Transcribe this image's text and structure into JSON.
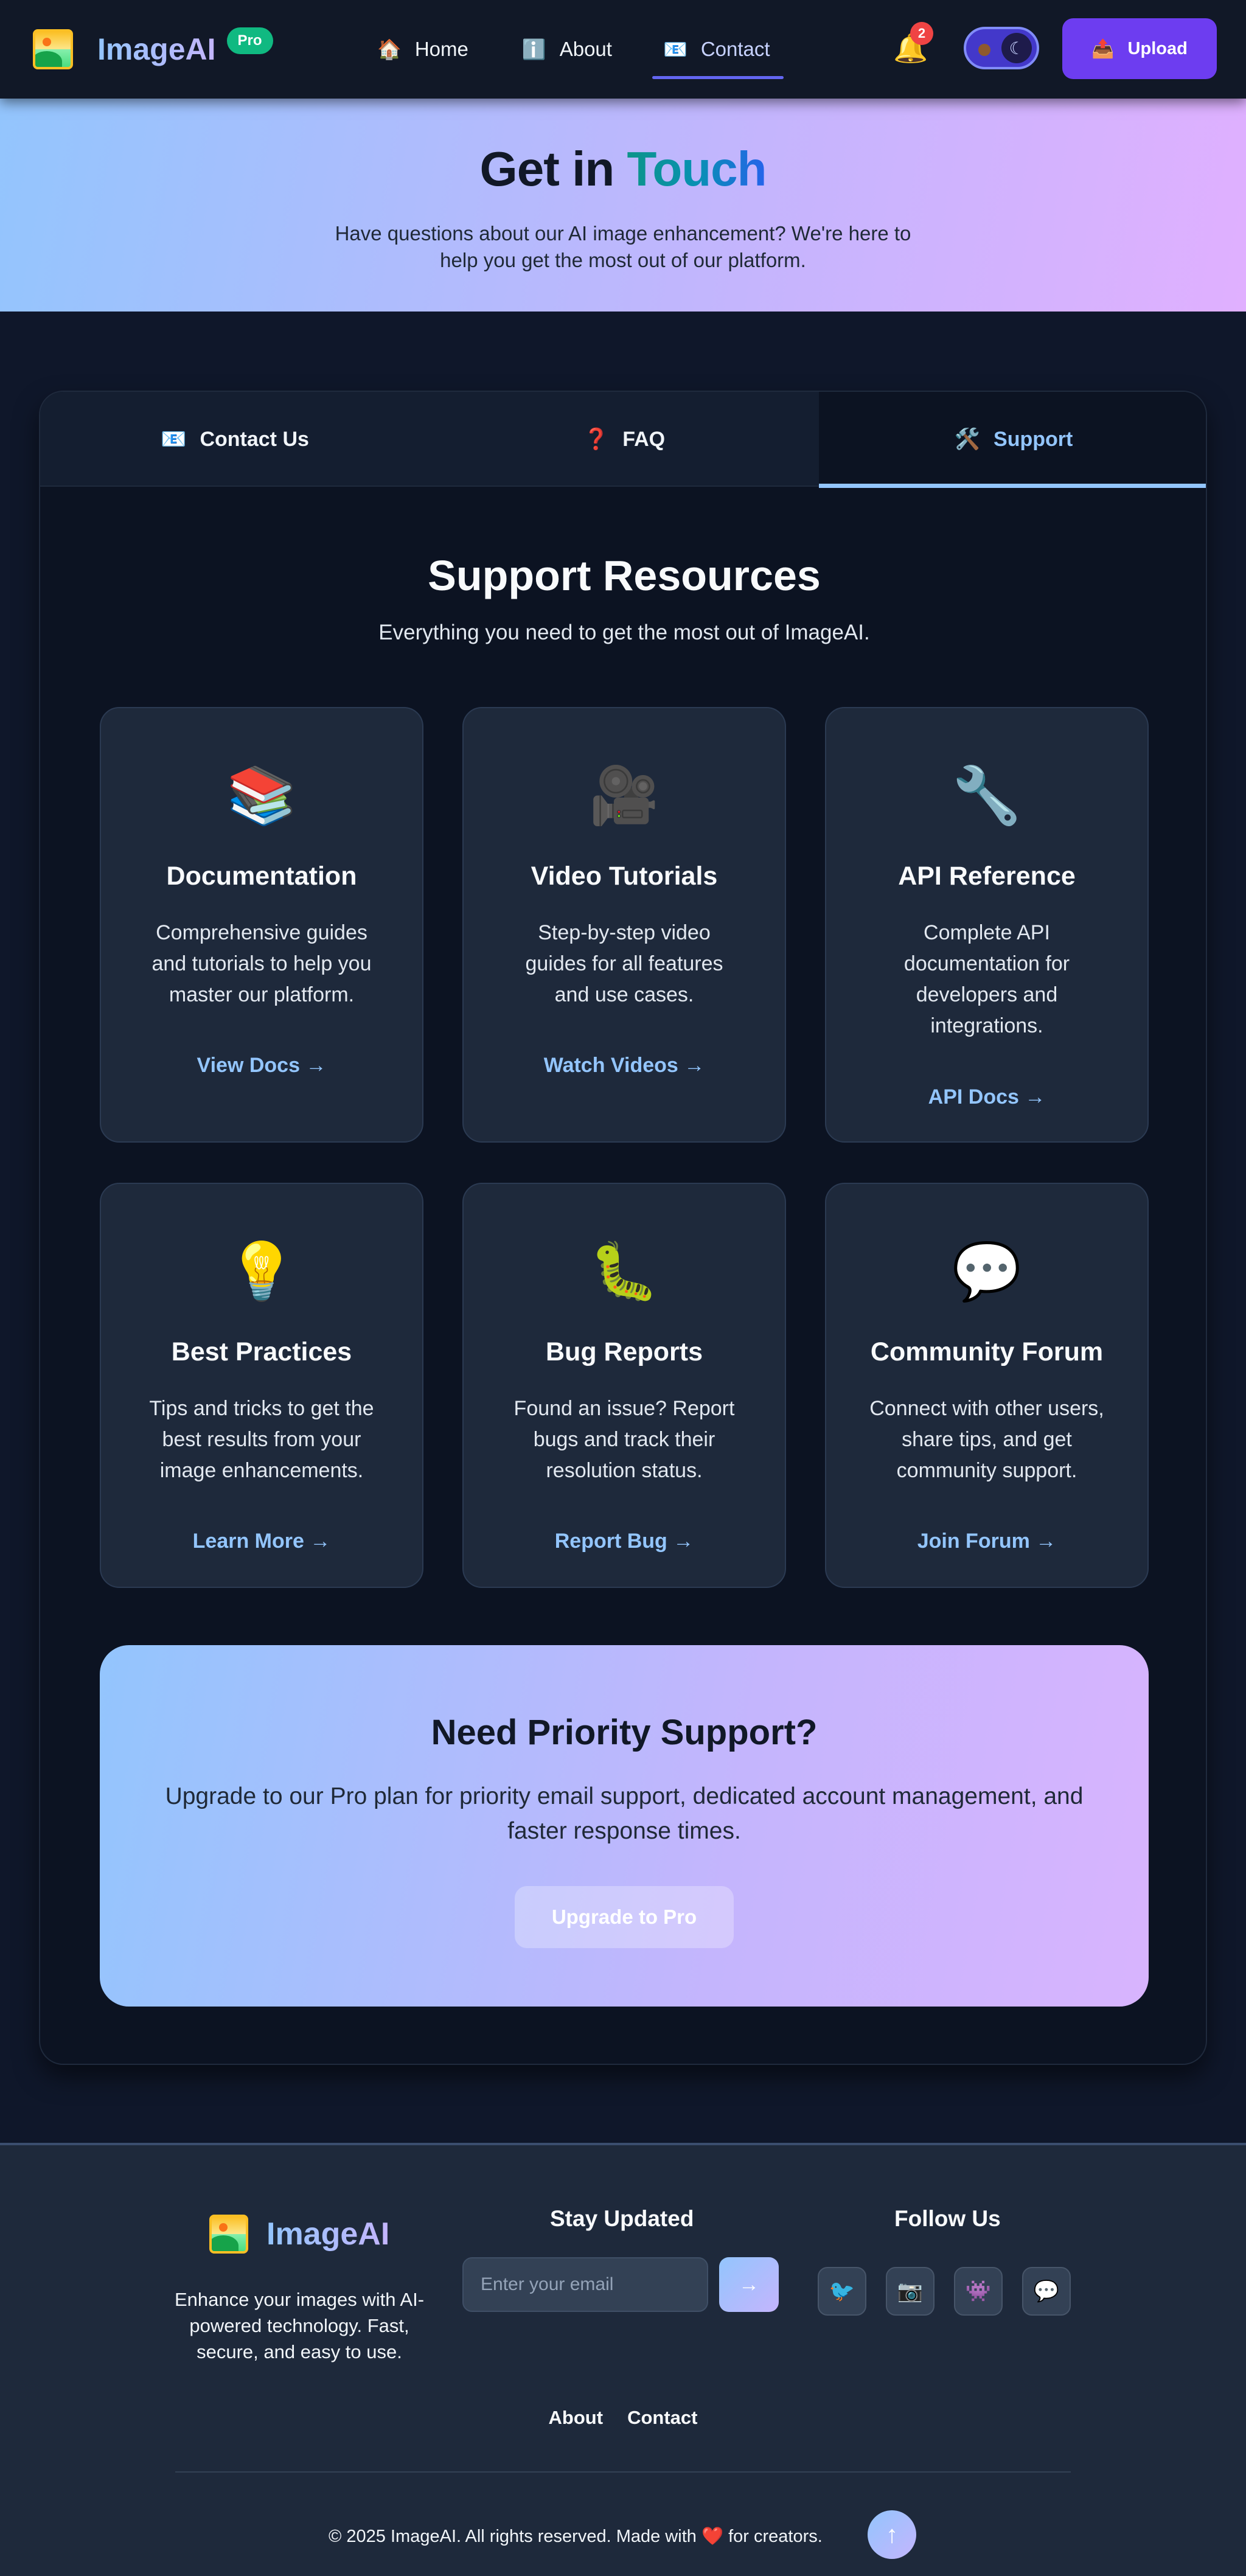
{
  "nav": {
    "brand": "ImageAI",
    "badge": "Pro",
    "links": [
      {
        "label": "Home",
        "icon": "🏠"
      },
      {
        "label": "About",
        "icon": "ℹ️"
      },
      {
        "label": "Contact",
        "icon": "📧"
      }
    ],
    "notification_count": "2",
    "upload_label": "Upload",
    "upload_icon": "📤"
  },
  "hero": {
    "title_part1": "Get in ",
    "title_part2": "Touch",
    "subtitle": "Have questions about our AI image enhancement? We're here to help you get the most out of our platform."
  },
  "tabs": [
    {
      "label": "Contact Us",
      "icon": "📧"
    },
    {
      "label": "FAQ",
      "icon": "❓"
    },
    {
      "label": "Support",
      "icon": "🛠️"
    }
  ],
  "support": {
    "title": "Support Resources",
    "subtitle": "Everything you need to get the most out of ImageAI.",
    "cards": [
      {
        "icon": "📚",
        "title": "Documentation",
        "desc": "Comprehensive guides and tutorials to help you master our platform.",
        "link": "View Docs →"
      },
      {
        "icon": "🎥",
        "title": "Video Tutorials",
        "desc": "Step-by-step video guides for all features and use cases.",
        "link": "Watch Videos →"
      },
      {
        "icon": "🔧",
        "title": "API Reference",
        "desc": "Complete API documentation for developers and integrations.",
        "link": "API Docs →"
      },
      {
        "icon": "💡",
        "title": "Best Practices",
        "desc": "Tips and tricks to get the best results from your image enhancements.",
        "link": "Learn More →"
      },
      {
        "icon": "🐛",
        "title": "Bug Reports",
        "desc": "Found an issue? Report bugs and track their resolution status.",
        "link": "Report Bug →"
      },
      {
        "icon": "💬",
        "title": "Community Forum",
        "desc": "Connect with other users, share tips, and get community support.",
        "link": "Join Forum →"
      }
    ]
  },
  "priority": {
    "title": "Need Priority Support?",
    "desc": "Upgrade to our Pro plan for priority email support, dedicated account management, and faster response times.",
    "button": "Upgrade to Pro"
  },
  "footer": {
    "brand": "ImageAI",
    "desc": "Enhance your images with AI-powered technology. Fast, secure, and easy to use.",
    "stay_title": "Stay Updated",
    "email_placeholder": "Enter your email",
    "submit_icon": "→",
    "follow_title": "Follow Us",
    "socials": [
      "🐦",
      "📷",
      "👾",
      "💬"
    ],
    "links": [
      "About",
      "Contact"
    ],
    "copyright_pre": "© 2025 ImageAI. All rights reserved. Made with ",
    "copyright_heart": "❤️",
    "copyright_post": " for creators.",
    "to_top_icon": "↑"
  }
}
